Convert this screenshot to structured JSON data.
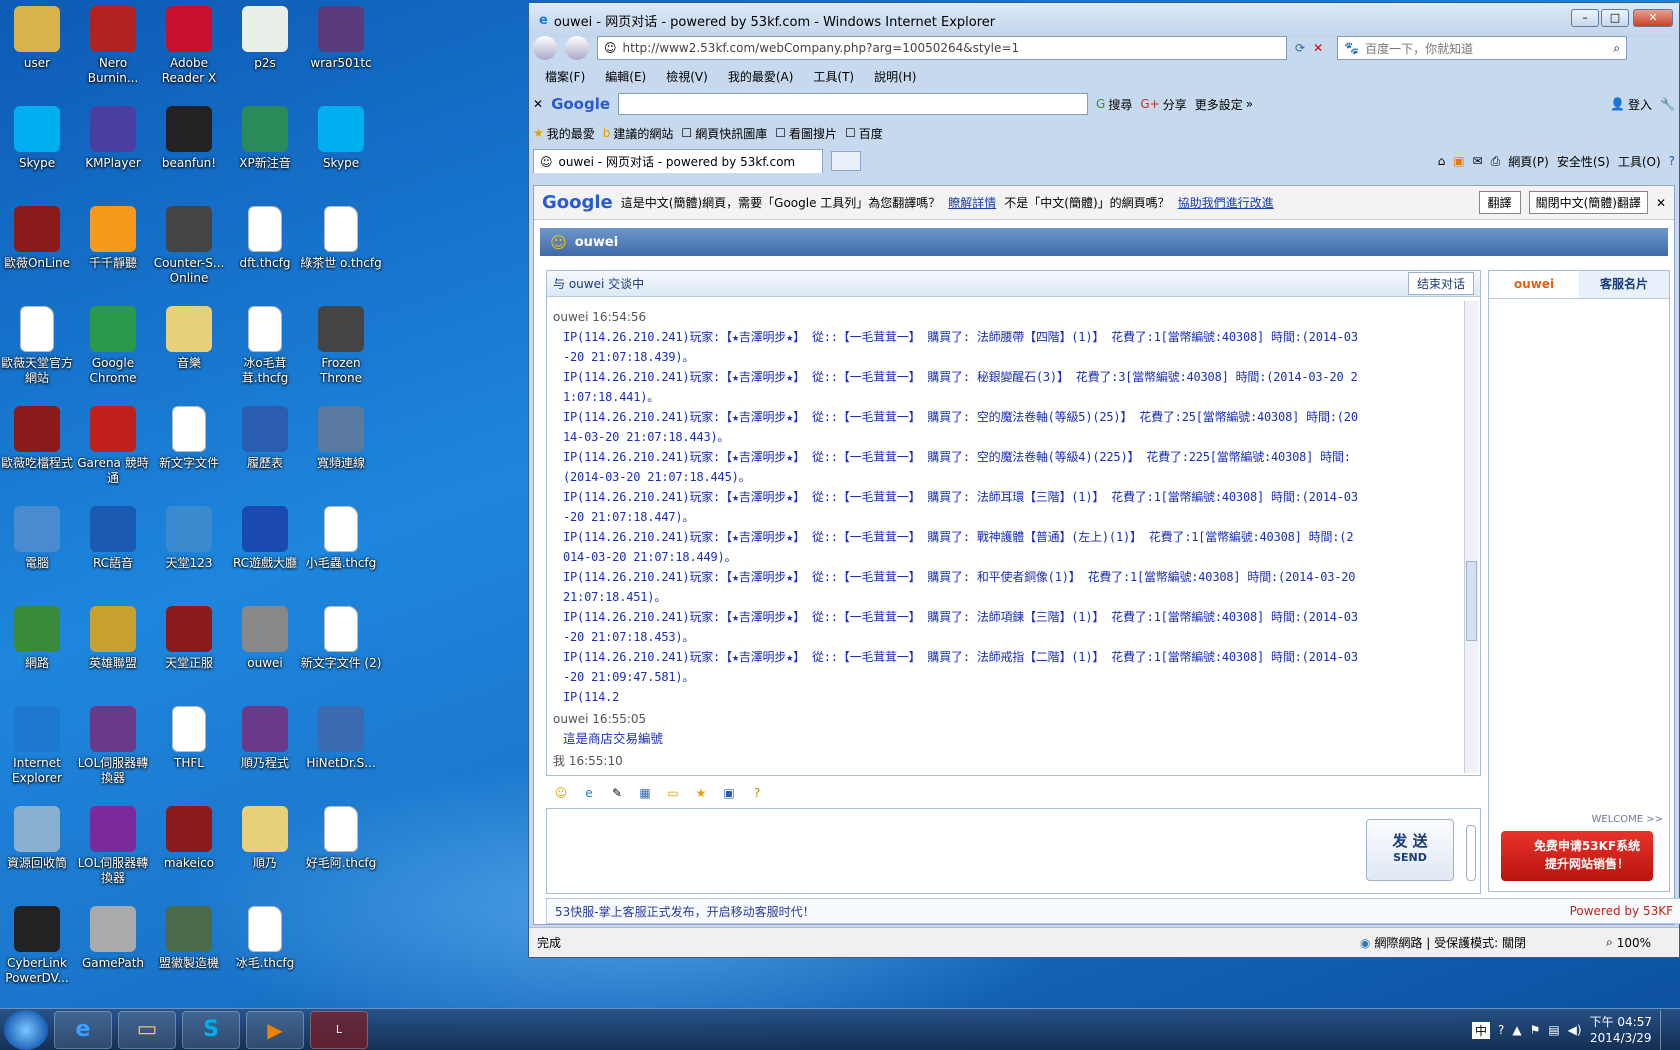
{
  "desktop_icons": [
    {
      "label": "user",
      "color": "#d8b24a"
    },
    {
      "label": "Nero Burnin...",
      "color": "#b22222"
    },
    {
      "label": "Adobe Reader X",
      "color": "#c8102e"
    },
    {
      "label": "p2s",
      "color": "#e8f0e8"
    },
    {
      "label": "wrar501tc",
      "color": "#5a3a7a"
    },
    {
      "label": "Skype",
      "color": "#00aff0"
    },
    {
      "label": "KMPlayer",
      "color": "#4a3ea0"
    },
    {
      "label": "beanfun!",
      "color": "#222"
    },
    {
      "label": "XP新注音",
      "color": "#2a8a5a"
    },
    {
      "label": "Skype",
      "color": "#00aff0"
    },
    {
      "label": "歐薇OnLine",
      "color": "#8b1a1a"
    },
    {
      "label": "千千靜聽",
      "color": "#f59a1a"
    },
    {
      "label": "Counter-S... Online",
      "color": "#444"
    },
    {
      "label": "dft.thcfg",
      "color": "#fff"
    },
    {
      "label": "綠茶世 o.thcfg",
      "color": "#fff"
    },
    {
      "label": "歐薇天堂官方網站",
      "color": "#fff"
    },
    {
      "label": "Google Chrome",
      "color": "#2a9a4a"
    },
    {
      "label": "音樂",
      "color": "#e8cf7a"
    },
    {
      "label": "冰o毛茸茸.thcfg",
      "color": "#fff"
    },
    {
      "label": "Frozen Throne",
      "color": "#444"
    },
    {
      "label": "歐薇吃檔程式",
      "color": "#8b1a1a"
    },
    {
      "label": "Garena 競時通",
      "color": "#c0201a"
    },
    {
      "label": "新文字文件",
      "color": "#fff"
    },
    {
      "label": "履歷表",
      "color": "#2a5db0"
    },
    {
      "label": "寬頻連線",
      "color": "#5a7aa0"
    },
    {
      "label": "電腦",
      "color": "#4a8ad0"
    },
    {
      "label": "RC語音",
      "color": "#1a5ab0"
    },
    {
      "label": "天堂123",
      "color": "#3a8ad0"
    },
    {
      "label": "RC遊戲大廳",
      "color": "#1a4ab0"
    },
    {
      "label": "小毛蟲.thcfg",
      "color": "#fff"
    },
    {
      "label": "網路",
      "color": "#3a8a3a"
    },
    {
      "label": "英雄聯盟",
      "color": "#c8a030"
    },
    {
      "label": "天堂正服",
      "color": "#8b1a1a"
    },
    {
      "label": "ouwei",
      "color": "#888"
    },
    {
      "label": "新文字文件 (2)",
      "color": "#fff"
    },
    {
      "label": "Internet Explorer",
      "color": "#1e78d0"
    },
    {
      "label": "LOL伺服器轉換器",
      "color": "#6a3a8a"
    },
    {
      "label": "THFL",
      "color": "#fff"
    },
    {
      "label": "順乃程式",
      "color": "#6a3a8a"
    },
    {
      "label": "HiNetDr.S...",
      "color": "#3a6ab0"
    },
    {
      "label": "資源回收筒",
      "color": "#8ab0d0"
    },
    {
      "label": "LOL伺服器轉換器",
      "color": "#7a2a9a"
    },
    {
      "label": "makeico",
      "color": "#8b1a1a"
    },
    {
      "label": "順乃",
      "color": "#e8cf7a"
    },
    {
      "label": "好毛阿.thcfg",
      "color": "#fff"
    },
    {
      "label": "CyberLink PowerDV...",
      "color": "#222"
    },
    {
      "label": "GamePath",
      "color": "#aaa"
    },
    {
      "label": "盟徽製造機",
      "color": "#4a6a4a"
    },
    {
      "label": "冰毛.thcfg",
      "color": "#fff"
    }
  ],
  "window": {
    "title": "ouwei - 网页对话 - powered by 53kf.com - Windows Internet Explorer",
    "url": "http://www2.53kf.com/webCompany.php?arg=10050264&style=1",
    "search_placeholder": "百度一下，你就知道",
    "menu": [
      "檔案(F)",
      "編輯(E)",
      "檢視(V)",
      "我的最愛(A)",
      "工具(T)",
      "說明(H)"
    ],
    "google_label": "Google",
    "google_search": "搜尋",
    "google_share": "分享",
    "google_more": "更多設定",
    "login": "登入",
    "fav_bar": [
      "我的最愛",
      "建議的網站",
      "網頁快訊圖庫",
      "看圖搜片",
      "百度"
    ],
    "tab_title": "ouwei - 网页对话 - powered by 53kf.com",
    "cmd": [
      "網頁(P)",
      "安全性(S)",
      "工具(O)"
    ],
    "translate_msg": "這是中文(簡體)網頁，需要「Google 工具列」為您翻譯嗎？",
    "translate_link1": "瞭解詳情",
    "translate_mid": "不是「中文(簡體)」的網頁嗎？",
    "translate_link2": "協助我們進行改進",
    "translate_btn": "翻譯",
    "translate_close_btn": "關閉中文(簡體)翻譯",
    "status_text": "完成",
    "status_zone": "網際網路 | 受保護模式: 關閉",
    "zoom": "100%"
  },
  "chat": {
    "header_name": "ouwei",
    "talking_with": "与 ouwei 交谈中",
    "end_btn": "结束对话",
    "messages": [
      {
        "meta": "ouwei 16:54:56",
        "mono": true,
        "lines": [
          "IP(114.26.210.241)玩家:【★吉澤明步★】 從::【一毛茸茸一】 購買了: 法師腰帶【四階】(1)】 花費了:1[當幣編號:40308] 時間:(2014-03",
          "-20 21:07:18.439)。",
          "IP(114.26.210.241)玩家:【★吉澤明步★】 從::【一毛茸茸一】 購買了: 秘銀變醒石(3)】 花費了:3[當幣編號:40308] 時間:(2014-03-20 2",
          "1:07:18.441)。",
          "IP(114.26.210.241)玩家:【★吉澤明步★】 從::【一毛茸茸一】 購買了: 空的魔法卷軸(等級5)(25)】 花費了:25[當幣編號:40308] 時間:(20",
          "14-03-20 21:07:18.443)。",
          "IP(114.26.210.241)玩家:【★吉澤明步★】 從::【一毛茸茸一】 購買了: 空的魔法卷軸(等級4)(225)】 花費了:225[當幣編號:40308] 時間:",
          "(2014-03-20 21:07:18.445)。",
          "IP(114.26.210.241)玩家:【★吉澤明步★】 從::【一毛茸茸一】 購買了: 法師耳環【三階】(1)】 花費了:1[當幣編號:40308] 時間:(2014-03",
          "-20 21:07:18.447)。",
          "IP(114.26.210.241)玩家:【★吉澤明步★】 從::【一毛茸茸一】 購買了: 戰神護體【普通】(左上)(1)】 花費了:1[當幣編號:40308] 時間:(2",
          "014-03-20 21:07:18.449)。",
          "IP(114.26.210.241)玩家:【★吉澤明步★】 從::【一毛茸茸一】 購買了: 和平使者銅像(1)】 花費了:1[當幣編號:40308] 時間:(2014-03-20",
          "21:07:18.451)。",
          "IP(114.26.210.241)玩家:【★吉澤明步★】 從::【一毛茸茸一】 購買了: 法師項鍊【三階】(1)】 花費了:1[當幣編號:40308] 時間:(2014-03",
          "-20 21:07:18.453)。",
          "IP(114.26.210.241)玩家:【★吉澤明步★】 從::【一毛茸茸一】 購買了: 法師戒指【二階】(1)】 花費了:1[當幣編號:40308] 時間:(2014-03",
          "-20 21:09:47.581)。",
          "IP(114.2"
        ]
      },
      {
        "meta": "ouwei 16:55:05",
        "mono": false,
        "lines": [
          "這是商店交易編號"
        ]
      },
      {
        "meta": "我 16:55:10",
        "mono": false,
        "lines": []
      }
    ],
    "send_cn": "发 送",
    "send_en": "SEND",
    "footer_note": "53快服-掌上客服正式发布，开启移动客服时代！",
    "powered": "Powered by 53KF",
    "side_tab1": "ouwei",
    "side_tab2": "客服名片",
    "welcome": "WELCOME >>",
    "ad_line1": "免费申请53KF系统",
    "ad_line2": "提升网站销售！"
  },
  "taskbar": {
    "time": "下午 04:57",
    "date": "2014/3/29",
    "ime": "中"
  }
}
